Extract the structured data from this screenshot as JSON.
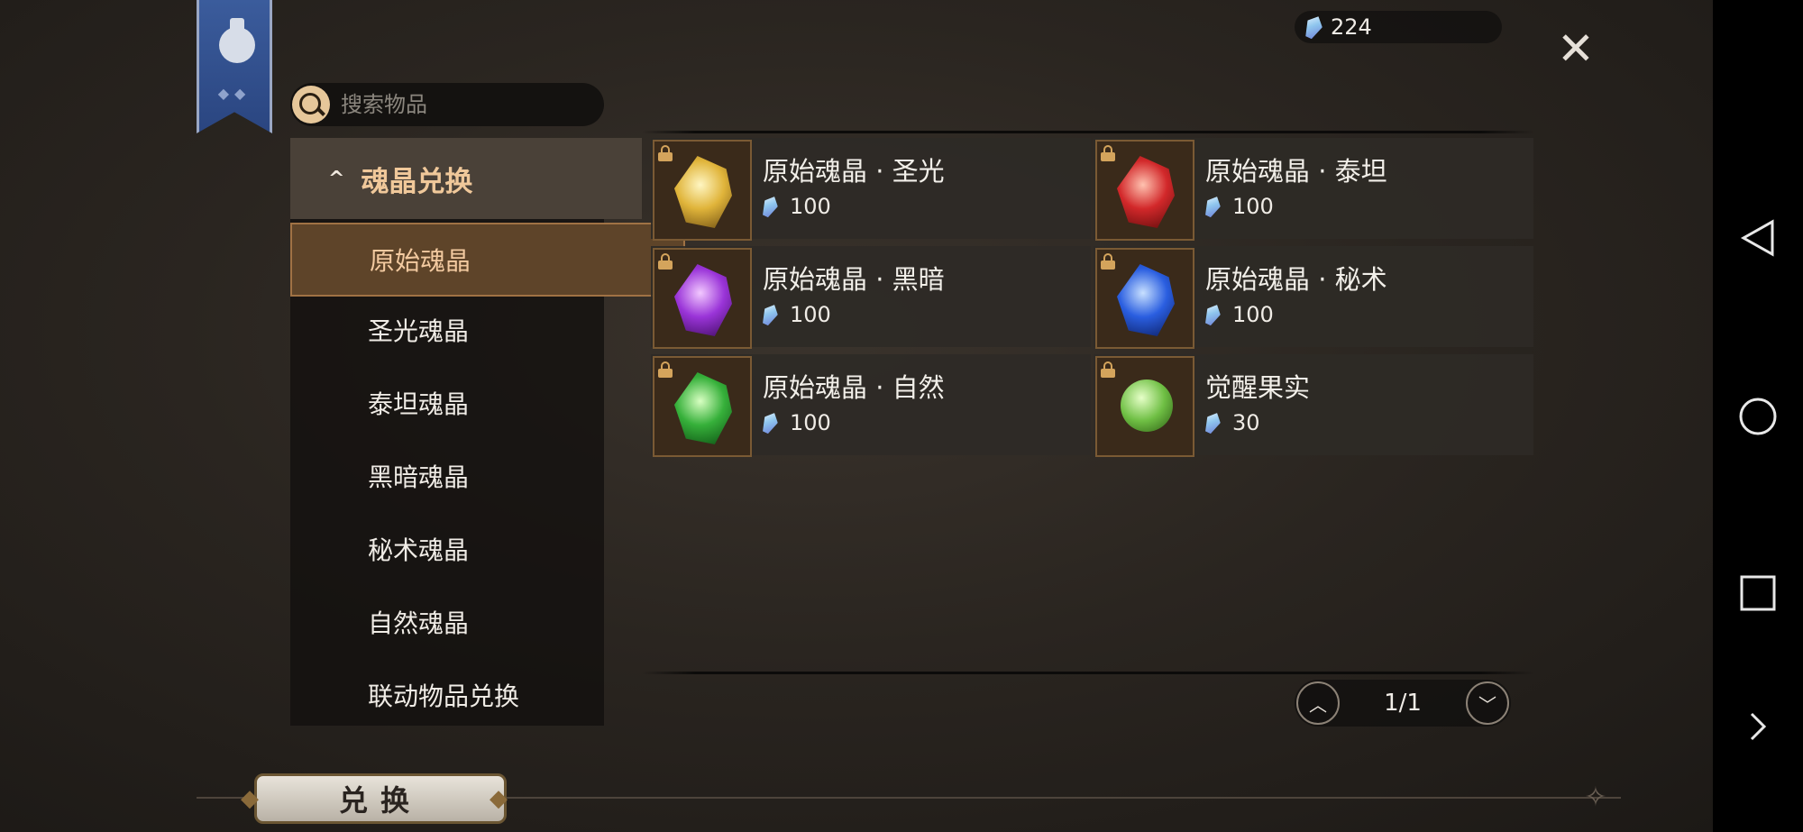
{
  "currency": {
    "amount": "224",
    "icon": "soul-gem-icon"
  },
  "search": {
    "placeholder": "搜索物品"
  },
  "sidebar": {
    "header": {
      "label": "魂晶兑换",
      "caret": "^"
    },
    "items": [
      {
        "label": "原始魂晶",
        "active": true
      },
      {
        "label": "圣光魂晶"
      },
      {
        "label": "泰坦魂晶"
      },
      {
        "label": "黑暗魂晶"
      },
      {
        "label": "秘术魂晶"
      },
      {
        "label": "自然魂晶"
      },
      {
        "label": "联动物品兑换"
      }
    ]
  },
  "items": [
    {
      "name": "原始魂晶 · 圣光",
      "price": "100",
      "locked": true,
      "color": "#e0b43a"
    },
    {
      "name": "原始魂晶 · 泰坦",
      "price": "100",
      "locked": true,
      "color": "#d2282a"
    },
    {
      "name": "原始魂晶 · 黑暗",
      "price": "100",
      "locked": true,
      "color": "#9a34d8"
    },
    {
      "name": "原始魂晶 · 秘术",
      "price": "100",
      "locked": true,
      "color": "#2a5ee0"
    },
    {
      "name": "原始魂晶 · 自然",
      "price": "100",
      "locked": true,
      "color": "#36b03a"
    },
    {
      "name": "觉醒果实",
      "price": "30",
      "locked": true,
      "color": "#6fbf44"
    }
  ],
  "pager": {
    "label": "1/1"
  },
  "bottom": {
    "exchange_label": "兑换"
  },
  "colors": {
    "accent": "#f0c89a",
    "active_bg": "#5e4429"
  }
}
